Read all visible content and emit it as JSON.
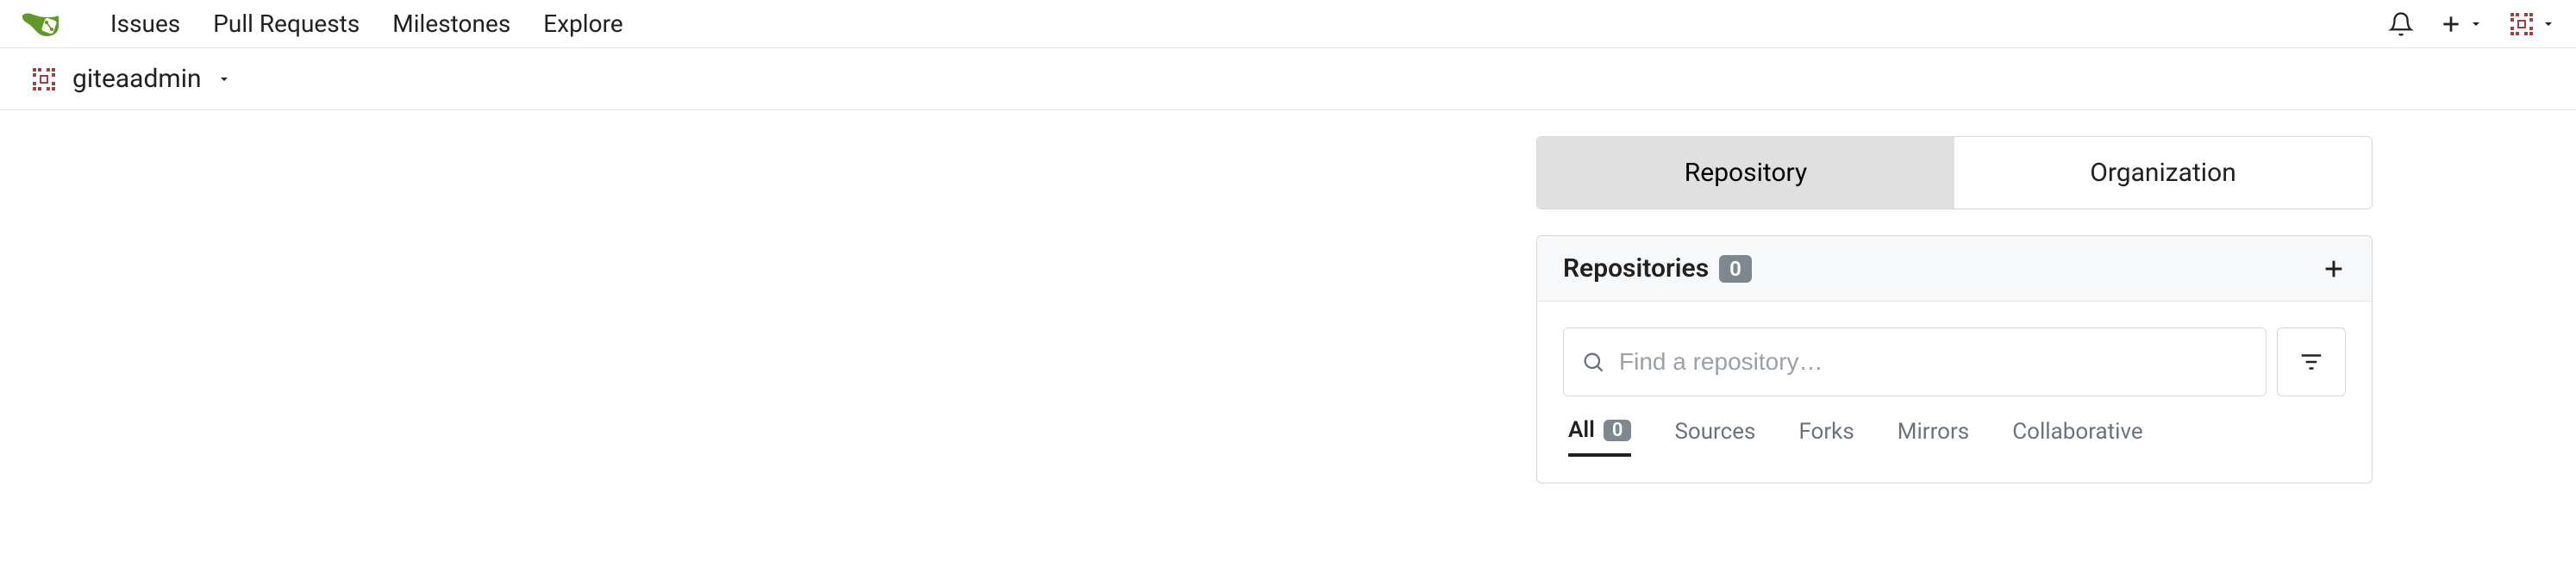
{
  "nav": {
    "issues": "Issues",
    "pull_requests": "Pull Requests",
    "milestones": "Milestones",
    "explore": "Explore"
  },
  "user": {
    "username": "giteaadmin"
  },
  "dashboard": {
    "tabs": {
      "repository": "Repository",
      "organization": "Organization"
    },
    "repos": {
      "title": "Repositories",
      "count": "0",
      "search_placeholder": "Find a repository…",
      "filters": {
        "all": "All",
        "all_count": "0",
        "sources": "Sources",
        "forks": "Forks",
        "mirrors": "Mirrors",
        "collaborative": "Collaborative"
      }
    }
  }
}
